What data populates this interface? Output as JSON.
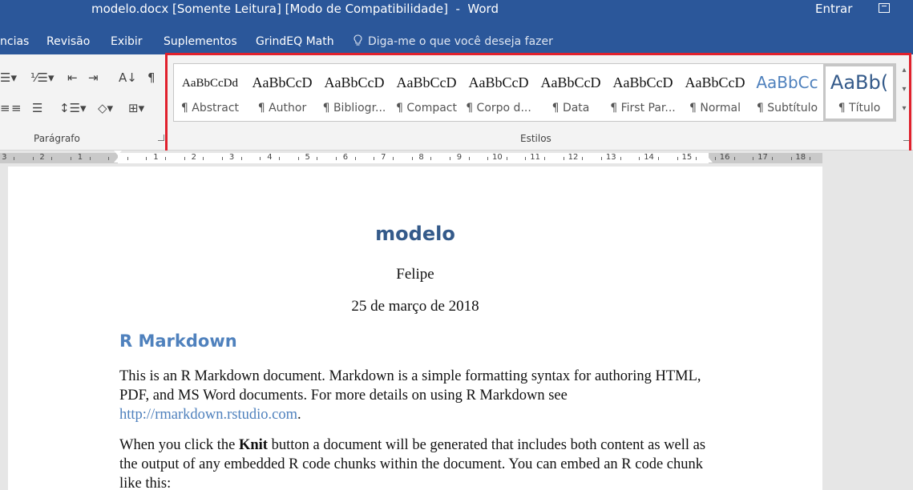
{
  "window": {
    "title": "modelo.docx [Somente Leitura] [Modo de Compatibilidade]  -  Word",
    "signin": "Entrar",
    "restore_icon": "restore-icon"
  },
  "tabs": [
    "ncias",
    "Revisão",
    "Exibir",
    "Suplementos",
    "GrindEQ Math"
  ],
  "tell_me": "Diga-me o que você deseja fazer",
  "ribbon": {
    "paragraph_group": {
      "label": "Parágrafo",
      "icons": [
        "bullets-icon",
        "numbering-icon",
        "decrease-indent-icon",
        "increase-indent-icon",
        "sort-icon",
        "show-marks-icon",
        "align-center-icon",
        "align-right-icon",
        "justify-icon",
        "line-spacing-icon",
        "shading-icon",
        "borders-icon"
      ]
    },
    "styles_group": {
      "label": "Estilos",
      "items": [
        {
          "sample": "AaBbCcDd",
          "name": "¶ Abstract"
        },
        {
          "sample": "AaBbCcD",
          "name": "¶ Author"
        },
        {
          "sample": "AaBbCcD",
          "name": "¶ Bibliogr..."
        },
        {
          "sample": "AaBbCcD",
          "name": "¶ Compact"
        },
        {
          "sample": "AaBbCcD",
          "name": "¶ Corpo d..."
        },
        {
          "sample": "AaBbCcD",
          "name": "¶ Data"
        },
        {
          "sample": "AaBbCcD",
          "name": "¶ First Par..."
        },
        {
          "sample": "AaBbCcD",
          "name": "¶ Normal"
        },
        {
          "sample": "AaBbCc",
          "name": "¶ Subtítulo"
        },
        {
          "sample": "AaBb(",
          "name": "¶ Título"
        }
      ],
      "selected_index": 9
    }
  },
  "ruler": {
    "left_numbers": [
      "3",
      "2",
      "1"
    ],
    "right_numbers": [
      "1",
      "2",
      "3",
      "4",
      "5",
      "6",
      "7",
      "8",
      "9",
      "10",
      "11",
      "12",
      "13",
      "14",
      "15",
      "16",
      "17",
      "18"
    ]
  },
  "document": {
    "title": "modelo",
    "author": "Felipe",
    "date": "25 de março de 2018",
    "heading": "R Markdown",
    "p1_text": "This is an R Markdown document. Markdown is a simple formatting syntax for authoring HTML, PDF, and MS Word documents. For more details on using R Markdown see ",
    "p1_link": "http://rmarkdown.rstudio.com",
    "p1_end": ".",
    "p2_before": "When you click the ",
    "p2_bold": "Knit",
    "p2_after": " button a document will be generated that includes both content as well as the output of any embedded R code chunks within the document. You can embed an R code chunk like this:"
  }
}
